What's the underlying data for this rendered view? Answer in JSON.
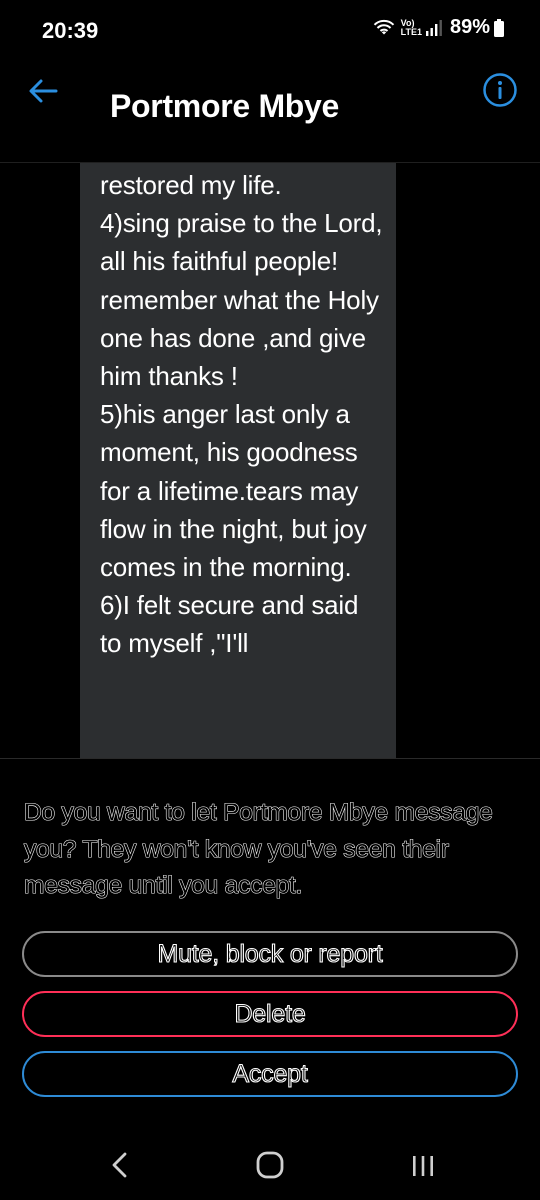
{
  "status_bar": {
    "time": "20:39",
    "network_top": "Vo)",
    "network_bottom": "LTE1",
    "battery": "89%",
    "icons": [
      "wifi-icon",
      "signal-icon",
      "battery-icon"
    ]
  },
  "header": {
    "title": "Portmore Mbye",
    "back_icon": "back-arrow-icon",
    "info_icon": "info-icon",
    "accent_color": "#2b8fe0"
  },
  "message": {
    "text": "restored my life.\n4)sing praise to the Lord, all his faithful people! remember what the Holy one has done ,and give him thanks !\n5)his anger last only a moment, his goodness for a lifetime.tears may flow in the night, but joy comes in the morning.\n6)I felt secure and said to myself ,\"I'll"
  },
  "request": {
    "prompt": "Do you want to let Portmore Mbye message you? They won't know you've seen their message until you accept.",
    "buttons": {
      "mute_label": "Mute, block or report",
      "delete_label": "Delete",
      "accept_label": "Accept"
    },
    "colors": {
      "mute_border": "#8a8a8a",
      "delete_border": "#ff2f57",
      "accept_border": "#2e8bd6"
    }
  },
  "nav_bar": {
    "icons": [
      "nav-back-icon",
      "nav-home-icon",
      "nav-recents-icon"
    ]
  }
}
